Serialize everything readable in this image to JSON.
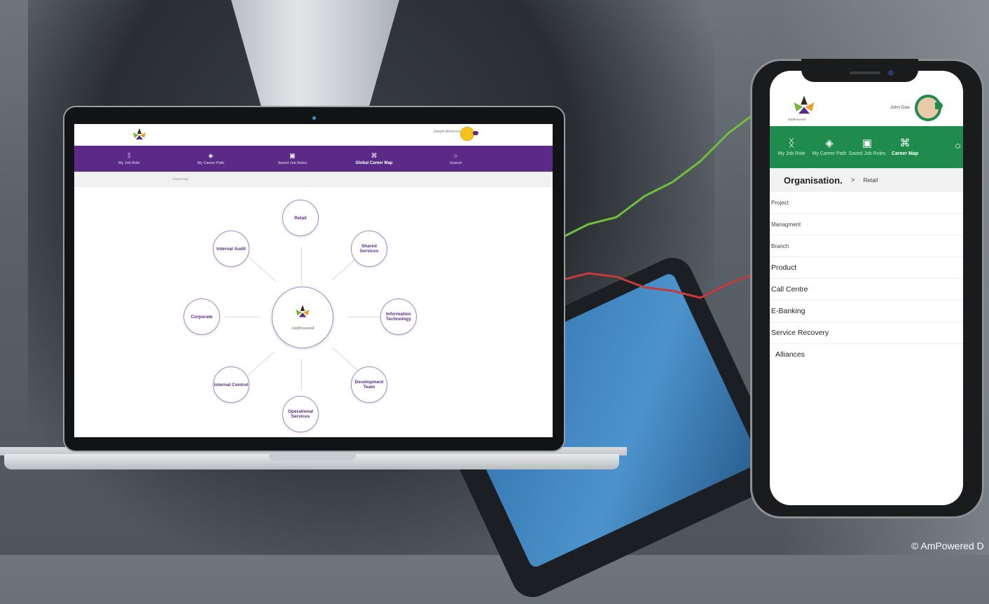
{
  "laptop": {
    "user_name": "Joseph Abourous",
    "nav": [
      {
        "label": "My Job Role",
        "icon": "tie-icon"
      },
      {
        "label": "My Career Path",
        "icon": "career-path-icon"
      },
      {
        "label": "Saved Job Roles",
        "icon": "bookmark-icon"
      },
      {
        "label": "Global Career Map",
        "icon": "org-chart-icon",
        "active": true
      },
      {
        "label": "Search",
        "icon": "search-icon"
      }
    ],
    "breadcrumb": "Global Map",
    "center_label": "AmPowered",
    "nodes": [
      "Retail",
      "Shared Services",
      "Information Technology",
      "Development Team",
      "Operational Services",
      "Internal Control",
      "Corporate",
      "Internal Audit"
    ]
  },
  "phone": {
    "logo_name": "AmPowered",
    "user_name": "John Doe",
    "nav": [
      {
        "label": "My Job Role",
        "icon": "tie-icon"
      },
      {
        "label": "My Career Path",
        "icon": "career-path-icon"
      },
      {
        "label": "Saved Job Roles",
        "icon": "bookmark-icon"
      },
      {
        "label": "Career Map",
        "icon": "org-chart-icon",
        "active": true
      }
    ],
    "breadcrumb": {
      "root": "Organisation.",
      "separator": ">",
      "current": "Retail"
    },
    "list": [
      "Project",
      "Managment",
      "Branch",
      "Product",
      "Call Centre",
      "E-Banking",
      "Service Recovery",
      "Alliances"
    ]
  },
  "copyright": "© AmPowered D",
  "colors": {
    "laptop_nav": "#5b2a86",
    "phone_nav": "#1f8b4c",
    "node_border": "#a78bc9"
  }
}
